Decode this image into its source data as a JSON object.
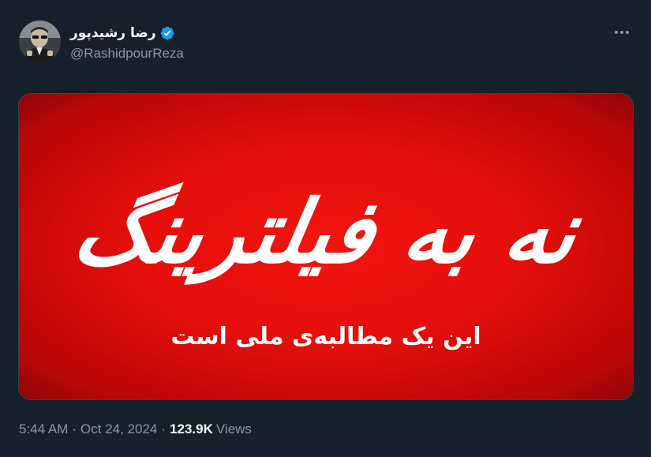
{
  "tweet": {
    "author": {
      "display_name": "رضا رشیدپور",
      "handle": "@RashidpourReza",
      "verified_icon": "verified-badge-icon",
      "avatar_icon": "avatar-photo"
    },
    "more_icon": "more-options-icon",
    "media": {
      "title": "نه به فیلترینگ",
      "subtitle": "این یک مطالبه‌ی ملی است",
      "background_color": "#e40e0b"
    },
    "meta": {
      "time": "5:44 AM",
      "separator": "·",
      "date": "Oct 24, 2024",
      "views_count": "123.9K",
      "views_label": "Views"
    }
  },
  "colors": {
    "background": "#15202b",
    "text_primary": "#f7f9f9",
    "text_secondary": "#8b98a5",
    "verified_blue": "#1d9bf0"
  }
}
